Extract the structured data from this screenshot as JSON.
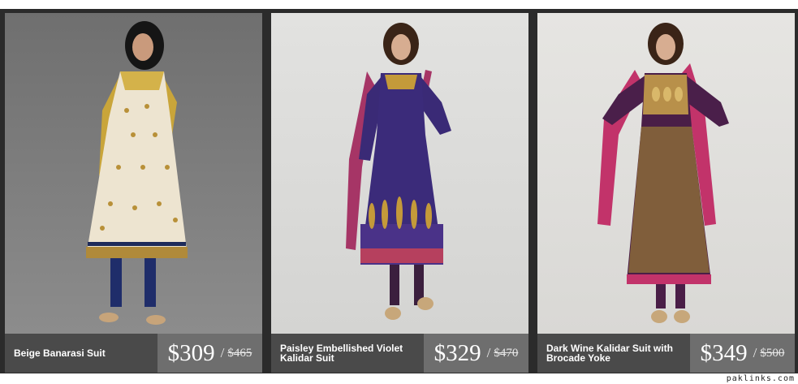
{
  "products": [
    {
      "title": "Beige Banarasi Suit",
      "price": "$309",
      "separator": "/",
      "old_price": "$465"
    },
    {
      "title": "Paisley Embellished Violet Kalidar Suit",
      "price": "$329",
      "separator": "/",
      "old_price": "$470"
    },
    {
      "title": "Dark Wine Kalidar Suit with Brocade Yoke",
      "price": "$349",
      "separator": "/",
      "old_price": "$500"
    }
  ],
  "watermark": "paklinks.com",
  "colors": {
    "caption_bar": "#4a4a4a",
    "price_box": "#6e6e6e",
    "frame": "#2b2b2b"
  }
}
